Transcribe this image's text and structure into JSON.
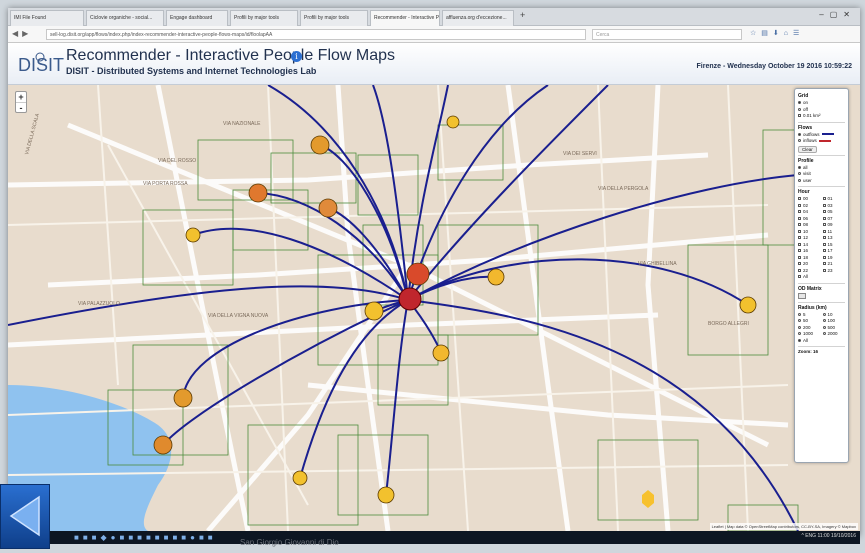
{
  "browser": {
    "tabs": [
      {
        "label": "IMI File Found"
      },
      {
        "label": "Ciclovie organiche - social..."
      },
      {
        "label": "Engage dashboard"
      },
      {
        "label": "Profili by major tools"
      },
      {
        "label": "Profili by major tools"
      },
      {
        "label": "Recommender - Interactive Pe..."
      },
      {
        "label": "affluenza.org d'eccezione..."
      }
    ],
    "url": "sell-log.disit.org/app/flows/index.php/index-recommender-interactive-people-flows-maps/id/floolapAA",
    "search_placeholder": "Cerca"
  },
  "header": {
    "logo_text": "DISIT",
    "title": "Recommender - Interactive People Flow Maps",
    "subtitle": "DISIT - Distributed Systems and Internet Technologies Lab",
    "datetime": "Firenze - Wednesday October 19 2016 10:59:22"
  },
  "map": {
    "zoom_in": "+",
    "zoom_out": "-",
    "streets": [
      {
        "label": "VIA DELLA SCALA"
      },
      {
        "label": "VIA NAZIONALE"
      },
      {
        "label": "VIA DEL ROSSO"
      },
      {
        "label": "VIA PALAZZUOLO"
      },
      {
        "label": "VIA DELLA VIGNA NUOVA"
      },
      {
        "label": "VIA DEI SERVI"
      },
      {
        "label": "VIA GHIBELLINA"
      },
      {
        "label": "BORGO ALLEGRI"
      },
      {
        "label": "VIA DELLA PERGOLA"
      },
      {
        "label": "VIA PORTA ROSSA"
      }
    ],
    "attribution": "Leaflet | Map data © OpenStreetMap contributors, CC-BY-SA, Imagery © Mapbox",
    "colors": {
      "base": "#e8dccd",
      "river": "#8fc2ef",
      "flow_line": "#1a1f8f",
      "grid": "#4c8c3c"
    }
  },
  "panel": {
    "grid": {
      "title": "Grid",
      "options": [
        "on",
        "off"
      ],
      "selected": "on",
      "cell_label": "0.01 km²"
    },
    "flows": {
      "title": "Flows",
      "outflows_label": "outflows",
      "inflows_label": "inflows",
      "outflows_color": "#1a1f8f",
      "inflows_color": "#c0262d",
      "selected": "outflows",
      "clear_label": "Clear"
    },
    "profile": {
      "title": "Profile",
      "options": [
        "all",
        "visit",
        "user"
      ],
      "selected": "all"
    },
    "hour": {
      "title": "Hour",
      "hours": [
        "00",
        "01",
        "02",
        "03",
        "04",
        "05",
        "06",
        "07",
        "08",
        "09",
        "10",
        "11",
        "12",
        "13",
        "14",
        "15",
        "16",
        "17",
        "18",
        "19",
        "20",
        "21",
        "22",
        "23"
      ],
      "all_label": "All"
    },
    "od_matrix": {
      "title": "OD Matrix"
    },
    "radius": {
      "title": "Radius (km)",
      "options": [
        "5",
        "10",
        "50",
        "100",
        "200",
        "500",
        "1000",
        "2000",
        "All"
      ],
      "selected": "All"
    },
    "zoom_label": "Zoom: 16"
  },
  "taskbar": {
    "tray_text": "^ ENG 11:00 19/10/2016"
  },
  "overlay": {
    "bottom_caption": "San Giorgio Giovanni di Dio"
  }
}
